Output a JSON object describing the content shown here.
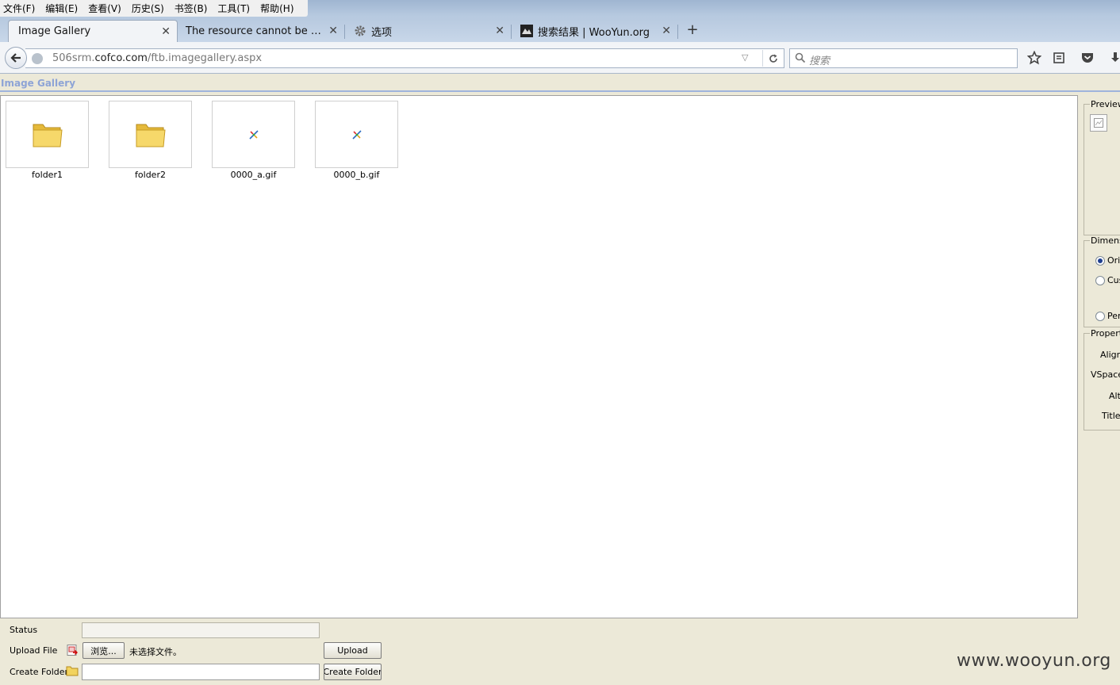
{
  "menu": {
    "items": [
      "文件(F)",
      "编辑(E)",
      "查看(V)",
      "历史(S)",
      "书签(B)",
      "工具(T)",
      "帮助(H)"
    ]
  },
  "tabs": [
    {
      "label": "Image Gallery",
      "active": true
    },
    {
      "label": "The resource cannot be fou...",
      "active": false
    },
    {
      "label": "选项",
      "active": false,
      "icon": "gear-icon"
    },
    {
      "label": "搜索结果 | WooYun.org",
      "active": false,
      "icon": "wooyun-favicon"
    }
  ],
  "nav": {
    "url_prefix": "506srm.",
    "url_domain": "cofco.com",
    "url_path": "/ftb.imagegallery.aspx",
    "search_placeholder": "搜索"
  },
  "page": {
    "title": "Image Gallery",
    "items": [
      {
        "name": "folder1",
        "type": "folder"
      },
      {
        "name": "folder2",
        "type": "folder"
      },
      {
        "name": "0000_a.gif",
        "type": "image"
      },
      {
        "name": "0000_b.gif",
        "type": "image"
      }
    ]
  },
  "panel": {
    "preview_legend": "Preview",
    "dimensions_legend": "Dimensio",
    "radio_original": "Orig",
    "radio_custom": "Cus",
    "radio_percent": "Per",
    "properties_legend": "Properti",
    "prop_align": "Align",
    "prop_vspace": "VSpace",
    "prop_alt": "Alt",
    "prop_title": "Title"
  },
  "form": {
    "status_label": "Status",
    "upload_label": "Upload File",
    "browse_button": "浏览...",
    "no_file_text": "未选择文件。",
    "upload_button": "Upload",
    "create_folder_label": "Create Folder",
    "create_folder_button": "Create Folder"
  },
  "watermark": "www.wooyun.org",
  "colors": {
    "page_title": "#8ea4d6",
    "page_background": "#ece9d8",
    "tabstrip": "#c8d7e9"
  }
}
